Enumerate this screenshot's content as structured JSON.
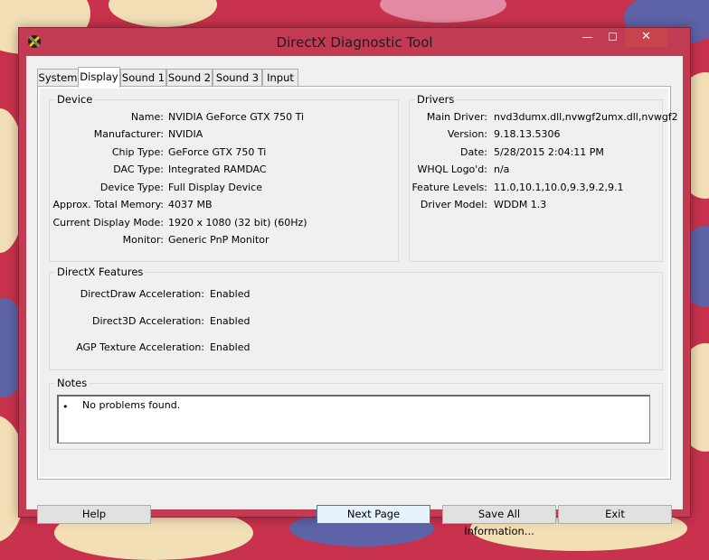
{
  "window": {
    "title": "DirectX Diagnostic Tool",
    "controls": {
      "minimize": "—",
      "maximize": "☐",
      "close": "✕"
    }
  },
  "tabs": [
    {
      "label": "System"
    },
    {
      "label": "Display"
    },
    {
      "label": "Sound 1"
    },
    {
      "label": "Sound 2"
    },
    {
      "label": "Sound 3"
    },
    {
      "label": "Input"
    }
  ],
  "active_tab": "Display",
  "device": {
    "title": "Device",
    "rows": [
      {
        "label": "Name:",
        "value": "NVIDIA GeForce GTX 750 Ti"
      },
      {
        "label": "Manufacturer:",
        "value": "NVIDIA"
      },
      {
        "label": "Chip Type:",
        "value": "GeForce GTX 750 Ti"
      },
      {
        "label": "DAC Type:",
        "value": "Integrated RAMDAC"
      },
      {
        "label": "Device Type:",
        "value": "Full Display Device"
      },
      {
        "label": "Approx. Total Memory:",
        "value": "4037 MB"
      },
      {
        "label": "Current Display Mode:",
        "value": "1920 x 1080 (32 bit) (60Hz)"
      },
      {
        "label": "Monitor:",
        "value": "Generic PnP Monitor"
      }
    ]
  },
  "drivers": {
    "title": "Drivers",
    "rows": [
      {
        "label": "Main Driver:",
        "value": "nvd3dumx.dll,nvwgf2umx.dll,nvwgf2"
      },
      {
        "label": "Version:",
        "value": "9.18.13.5306"
      },
      {
        "label": "Date:",
        "value": "5/28/2015 2:04:11 PM"
      },
      {
        "label": "WHQL Logo'd:",
        "value": "n/a"
      },
      {
        "label": "Feature Levels:",
        "value": "11.0,10.1,10.0,9.3,9.2,9.1"
      },
      {
        "label": "Driver Model:",
        "value": "WDDM 1.3"
      }
    ]
  },
  "features": {
    "title": "DirectX Features",
    "rows": [
      {
        "label": "DirectDraw Acceleration:",
        "value": "Enabled"
      },
      {
        "label": "Direct3D Acceleration:",
        "value": "Enabled"
      },
      {
        "label": "AGP Texture Acceleration:",
        "value": "Enabled"
      }
    ]
  },
  "notes": {
    "title": "Notes",
    "items": [
      "No problems found."
    ]
  },
  "buttons": {
    "help": "Help",
    "next_page": "Next Page",
    "save_all": "Save All Information...",
    "exit": "Exit"
  },
  "colors": {
    "wallpaper": "#c8324c",
    "window_frame": "#c33a53",
    "close_button": "#c7444a",
    "client_bg": "#f0f0f0",
    "default_button_border": "#3c7fb1"
  }
}
